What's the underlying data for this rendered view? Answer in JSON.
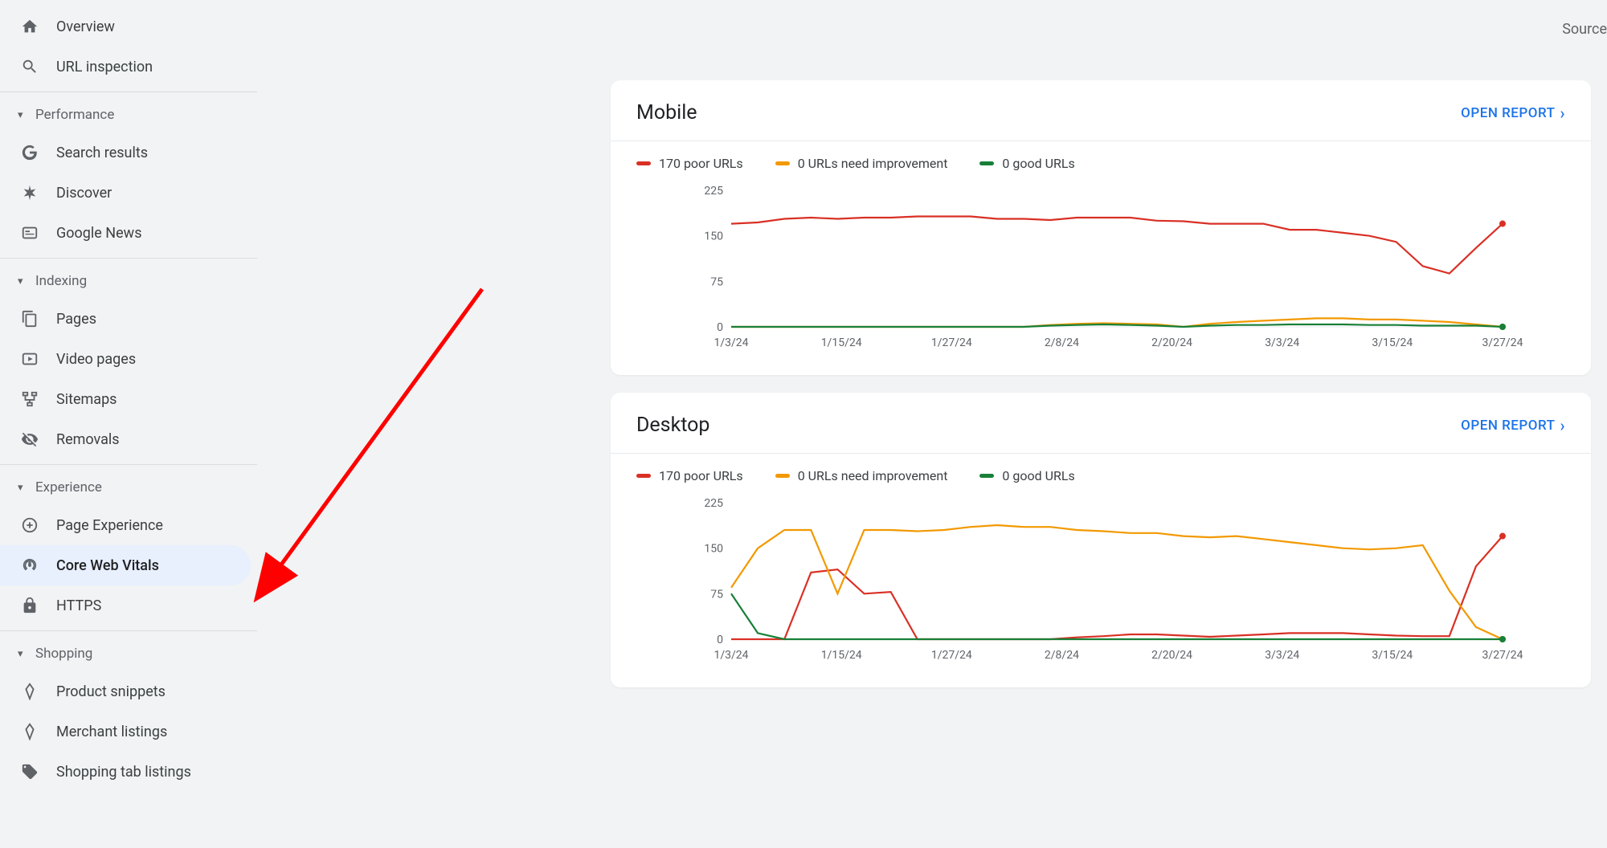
{
  "source_label": "Source",
  "sidebar": {
    "top_items": [
      {
        "id": "overview",
        "label": "Overview",
        "icon": "home"
      },
      {
        "id": "url-inspection",
        "label": "URL inspection",
        "icon": "search"
      }
    ],
    "sections": [
      {
        "id": "performance",
        "label": "Performance",
        "items": [
          {
            "id": "search-results",
            "label": "Search results",
            "icon": "google-g"
          },
          {
            "id": "discover",
            "label": "Discover",
            "icon": "asterisk"
          },
          {
            "id": "google-news",
            "label": "Google News",
            "icon": "news"
          }
        ]
      },
      {
        "id": "indexing",
        "label": "Indexing",
        "items": [
          {
            "id": "pages",
            "label": "Pages",
            "icon": "pages"
          },
          {
            "id": "video-pages",
            "label": "Video pages",
            "icon": "video"
          },
          {
            "id": "sitemaps",
            "label": "Sitemaps",
            "icon": "sitemap"
          },
          {
            "id": "removals",
            "label": "Removals",
            "icon": "eye-off"
          }
        ]
      },
      {
        "id": "experience",
        "label": "Experience",
        "items": [
          {
            "id": "page-experience",
            "label": "Page Experience",
            "icon": "plus-circle"
          },
          {
            "id": "core-web-vitals",
            "label": "Core Web Vitals",
            "icon": "speed",
            "selected": true
          },
          {
            "id": "https",
            "label": "HTTPS",
            "icon": "lock"
          }
        ]
      },
      {
        "id": "shopping",
        "label": "Shopping",
        "items": [
          {
            "id": "product-snippets",
            "label": "Product snippets",
            "icon": "diamond"
          },
          {
            "id": "merchant-listings",
            "label": "Merchant listings",
            "icon": "diamond"
          },
          {
            "id": "shopping-tab",
            "label": "Shopping tab listings",
            "icon": "tag"
          }
        ]
      }
    ]
  },
  "colors": {
    "poor": "#d93025",
    "need": "#f29900",
    "good": "#188038"
  },
  "cards": [
    {
      "id": "mobile",
      "title": "Mobile",
      "open_report": "OPEN REPORT",
      "legend": [
        {
          "label": "170 poor URLs",
          "color": "#d93025"
        },
        {
          "label": "0 URLs need improvement",
          "color": "#f29900"
        },
        {
          "label": "0 good URLs",
          "color": "#188038"
        }
      ]
    },
    {
      "id": "desktop",
      "title": "Desktop",
      "open_report": "OPEN REPORT",
      "legend": [
        {
          "label": "170 poor URLs",
          "color": "#d93025"
        },
        {
          "label": "0 URLs need improvement",
          "color": "#f29900"
        },
        {
          "label": "0 good URLs",
          "color": "#188038"
        }
      ]
    }
  ],
  "chart_data": [
    {
      "type": "line",
      "title": "Mobile",
      "xlabel": "",
      "ylabel": "",
      "ylim": [
        0,
        225
      ],
      "y_ticks": [
        0,
        75,
        150,
        225
      ],
      "x_categories": [
        "1/3/24",
        "1/15/24",
        "1/27/24",
        "2/8/24",
        "2/20/24",
        "3/3/24",
        "3/15/24",
        "3/27/24"
      ],
      "series": [
        {
          "name": "poor",
          "color": "#d93025",
          "values": [
            170,
            172,
            178,
            180,
            178,
            180,
            180,
            182,
            182,
            182,
            178,
            178,
            176,
            180,
            180,
            180,
            175,
            174,
            170,
            170,
            170,
            160,
            160,
            155,
            150,
            140,
            100,
            88,
            130,
            170
          ]
        },
        {
          "name": "need",
          "color": "#f29900",
          "values": [
            0,
            0,
            0,
            0,
            0,
            0,
            0,
            0,
            0,
            0,
            0,
            0,
            3,
            5,
            6,
            5,
            4,
            0,
            5,
            8,
            10,
            12,
            14,
            14,
            12,
            12,
            10,
            8,
            4,
            0
          ]
        },
        {
          "name": "good",
          "color": "#188038",
          "values": [
            0,
            0,
            0,
            0,
            0,
            0,
            0,
            0,
            0,
            0,
            0,
            0,
            2,
            3,
            4,
            3,
            2,
            0,
            2,
            3,
            3,
            4,
            4,
            4,
            3,
            3,
            2,
            2,
            2,
            0
          ]
        }
      ]
    },
    {
      "type": "line",
      "title": "Desktop",
      "xlabel": "",
      "ylabel": "",
      "ylim": [
        0,
        225
      ],
      "y_ticks": [
        0,
        75,
        150,
        225
      ],
      "x_categories": [
        "1/3/24",
        "1/15/24",
        "1/27/24",
        "2/8/24",
        "2/20/24",
        "3/3/24",
        "3/15/24",
        "3/27/24"
      ],
      "series": [
        {
          "name": "poor",
          "color": "#d93025",
          "values": [
            0,
            0,
            0,
            110,
            115,
            75,
            78,
            0,
            0,
            0,
            0,
            0,
            0,
            3,
            5,
            8,
            8,
            6,
            4,
            6,
            8,
            10,
            10,
            10,
            8,
            6,
            5,
            5,
            120,
            170
          ]
        },
        {
          "name": "need",
          "color": "#f29900",
          "values": [
            85,
            150,
            180,
            180,
            75,
            180,
            180,
            178,
            180,
            185,
            188,
            185,
            185,
            180,
            178,
            175,
            175,
            170,
            168,
            170,
            165,
            160,
            155,
            150,
            148,
            150,
            155,
            80,
            20,
            0
          ]
        },
        {
          "name": "good",
          "color": "#188038",
          "values": [
            75,
            10,
            0,
            0,
            0,
            0,
            0,
            0,
            0,
            0,
            0,
            0,
            0,
            0,
            0,
            0,
            0,
            0,
            0,
            0,
            0,
            0,
            0,
            0,
            0,
            0,
            0,
            0,
            0,
            0
          ]
        }
      ]
    }
  ]
}
